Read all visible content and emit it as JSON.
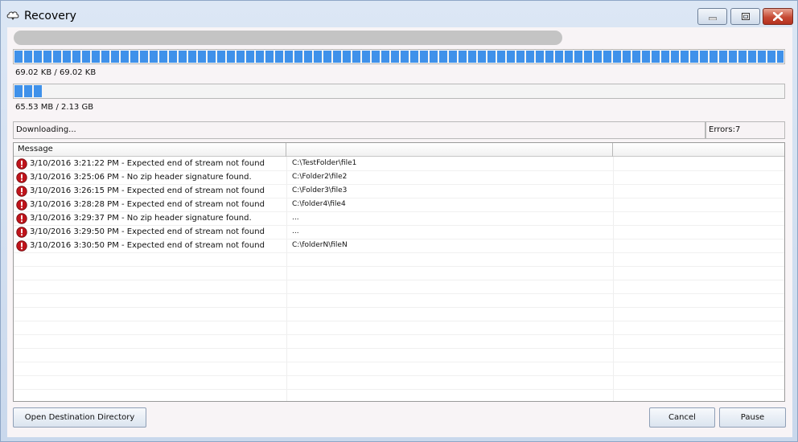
{
  "window": {
    "title": "Recovery",
    "icon": "cloud-icon",
    "controls": [
      "minimize-icon",
      "maximize-icon",
      "close-icon"
    ]
  },
  "progress": {
    "file": {
      "label": "69.02 KB / 69.02 KB",
      "fraction": 1.0
    },
    "total": {
      "label": "65.53 MB / 2.13 GB",
      "fraction": 0.036
    }
  },
  "status": {
    "text": "Downloading...",
    "errors": "Errors:7"
  },
  "log": {
    "columns": [
      "Message",
      "",
      ""
    ],
    "rows": [
      {
        "icon": "error-icon",
        "message": "3/10/2016 3:21:22 PM - Expected end of stream not found",
        "path": "C:\\TestFolder\\file1"
      },
      {
        "icon": "error-icon",
        "message": "3/10/2016 3:25:06 PM - No zip header signature found.",
        "path": "C:\\Folder2\\file2"
      },
      {
        "icon": "error-icon",
        "message": "3/10/2016 3:26:15 PM - Expected end of stream not found",
        "path": "C:\\Folder3\\file3"
      },
      {
        "icon": "error-icon",
        "message": "3/10/2016 3:28:28 PM - Expected end of stream not found",
        "path": "C:\\folder4\\file4"
      },
      {
        "icon": "error-icon",
        "message": "3/10/2016 3:29:37 PM - No zip header signature found.",
        "path": "..."
      },
      {
        "icon": "error-icon",
        "message": "3/10/2016 3:29:50 PM - Expected end of stream not found",
        "path": "..."
      },
      {
        "icon": "error-icon",
        "message": "3/10/2016 3:30:50 PM - Expected end of stream not found",
        "path": "C:\\folderN\\fileN"
      }
    ],
    "empty_rows": 11
  },
  "buttons": {
    "open_destination": "Open Destination Directory",
    "cancel": "Cancel",
    "pause": "Pause"
  },
  "colors": {
    "progress_fill": "#3f91ea",
    "error_icon": "#c0141b"
  }
}
